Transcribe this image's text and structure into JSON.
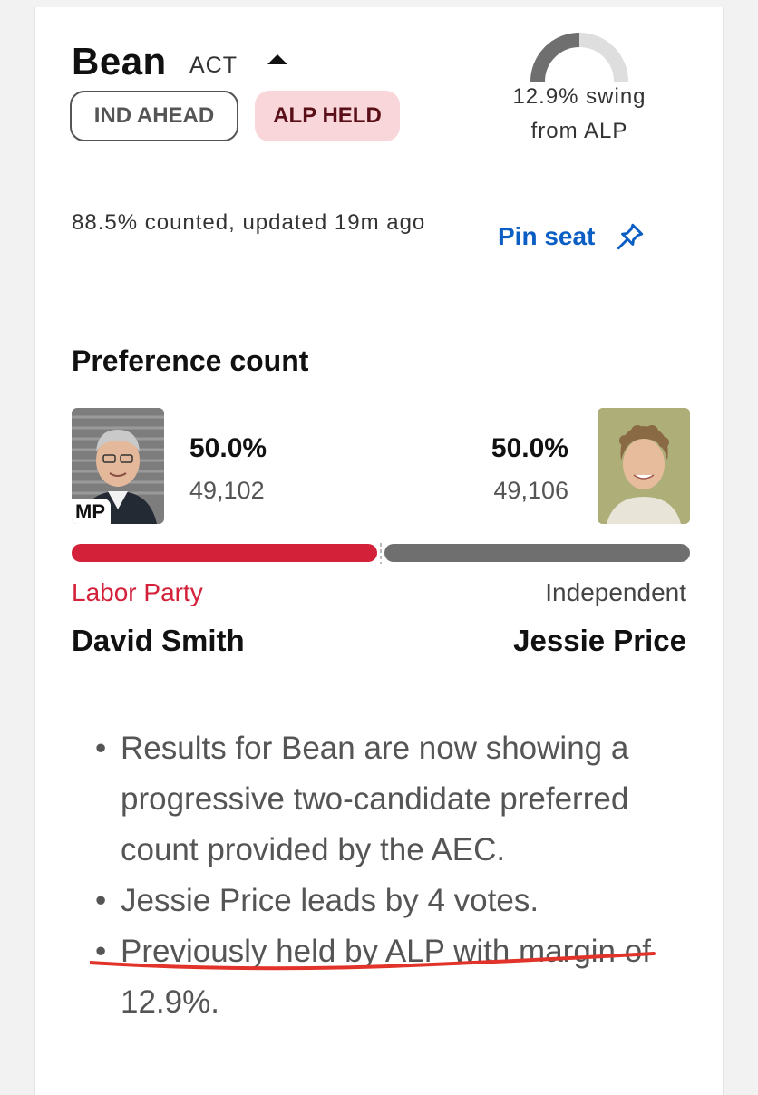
{
  "seat": {
    "name": "Bean",
    "state": "ACT"
  },
  "status": {
    "ind": "IND AHEAD",
    "alp": "ALP HELD"
  },
  "swing": {
    "line1": "12.9% swing",
    "line2": "from ALP",
    "fraction": 0.129
  },
  "counted": "88.5% counted, updated 19m ago",
  "pin": {
    "label": "Pin seat"
  },
  "preference": {
    "title": "Preference count",
    "left": {
      "pct": "50.0%",
      "votes": "49,102",
      "party": "Labor Party",
      "name": "David Smith",
      "tag": "MP",
      "color": "#d3213a"
    },
    "right": {
      "pct": "50.0%",
      "votes": "49,106",
      "party": "Independent",
      "name": "Jessie Price",
      "color": "#6f6f6f"
    },
    "share_left": 0.49998
  },
  "notes": [
    "Results for Bean are now showing a progressive two-candidate preferred count provided by the AEC.",
    "Jessie Price leads by 4 votes.",
    "Previously held by ALP with margin of 12.9%."
  ],
  "colors": {
    "alp_badge_bg": "#f8d6da",
    "pin_blue": "#0b5fc4",
    "labor_red": "#d3213a",
    "annotation_red": "#e2332a"
  },
  "icons": {
    "pin": "pin-icon",
    "caret": "caret-up-icon"
  }
}
